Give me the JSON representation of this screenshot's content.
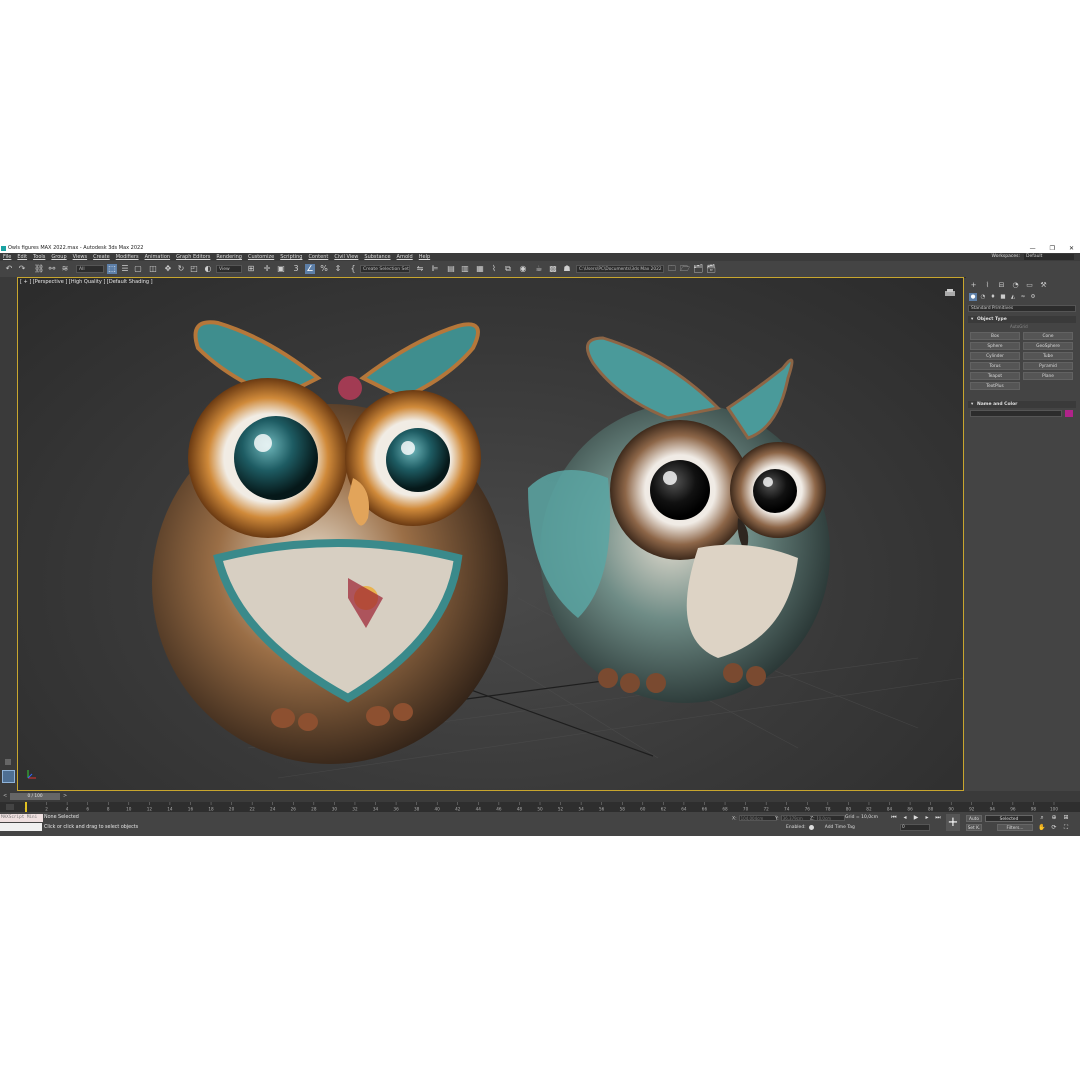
{
  "window": {
    "title": "Owls figures MAX 2022.max - Autodesk 3ds Max 2022",
    "controls": [
      "—",
      "❐",
      "✕"
    ]
  },
  "menubar": {
    "items": [
      "File",
      "Edit",
      "Tools",
      "Group",
      "Views",
      "Create",
      "Modifiers",
      "Animation",
      "Graph Editors",
      "Rendering",
      "Customize",
      "Scripting",
      "Content",
      "Civil View",
      "Substance",
      "Arnold",
      "Help"
    ],
    "workspaces_label": "Workspaces:",
    "workspace_value": "Default"
  },
  "toolbar": {
    "filter_value": "All",
    "view_value": "View",
    "selection_set_value": "Create Selection Set",
    "path_value": "C:\\Users\\PC\\Documents\\3ds Max 2022",
    "snap_label": "3",
    "percent_label": "%"
  },
  "viewport": {
    "label": "[ + ] [Perspective ] [High Quality ] [Default Shading ]",
    "border_color": "#c8a62e"
  },
  "command_panel": {
    "category_value": "Standard Primitives",
    "object_type_label": "Object Type",
    "autogrid_label": "AutoGrid",
    "buttons": [
      "Box",
      "Cone",
      "Sphere",
      "GeoSphere",
      "Cylinder",
      "Tube",
      "Torus",
      "Pyramid",
      "Teapot",
      "Plane",
      "TextPlus"
    ],
    "name_color_label": "Name and Color",
    "swatch_color": "#b0238a"
  },
  "timeline": {
    "frame_display": "0 / 100",
    "prev": "<",
    "next": ">",
    "ticks": [
      0,
      2,
      4,
      6,
      8,
      10,
      12,
      14,
      16,
      18,
      20,
      22,
      24,
      26,
      28,
      30,
      32,
      34,
      36,
      38,
      40,
      42,
      44,
      46,
      48,
      50,
      52,
      54,
      56,
      58,
      60,
      62,
      64,
      66,
      68,
      70,
      72,
      74,
      76,
      78,
      80,
      82,
      84,
      86,
      88,
      90,
      92,
      94,
      96,
      98,
      100
    ]
  },
  "status": {
    "maxscript_label": "MAXScript Mini",
    "selection_text": "None Selected",
    "prompt_text": "Click or click and drag to select objects",
    "x_label": "X:",
    "y_label": "Y:",
    "z_label": "Z:",
    "x_value": "104,004cm",
    "y_value": "36,379cm",
    "z_value": "0,0cm",
    "grid_text": "Grid = 10,0cm",
    "enabled_label": "Enabled:",
    "add_time_tag": "Add Time Tag",
    "auto_label": "Auto",
    "selected_value": "Selected",
    "setk_label": "Set K.",
    "filters_label": "Filters...",
    "frame_value": "0"
  }
}
